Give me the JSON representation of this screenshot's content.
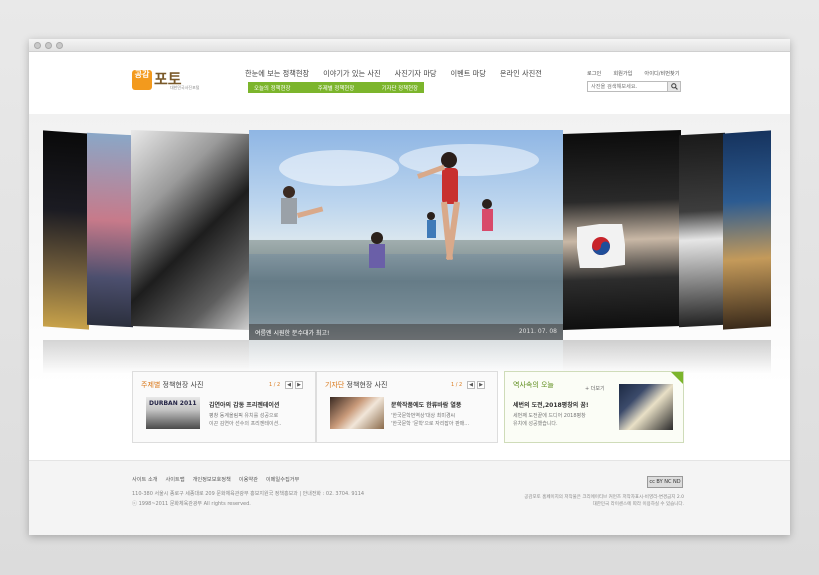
{
  "nav": {
    "items": [
      "한눈에 보는 정책현장",
      "이야기가 있는 사진",
      "사진기자 마당",
      "이벤트 마당",
      "온라인 사진전"
    ],
    "sub_items": [
      "오늘의 정책현장",
      "주제별 정책현장",
      "기자단 정책현장"
    ]
  },
  "brand": {
    "logo_box": "공감",
    "logo_text": "포토",
    "logo_sub": "대한민국사진포털",
    "accent_color": "#f39a1d",
    "green_color": "#7cb52c"
  },
  "util": {
    "links": [
      "로그인",
      "회원가입",
      "아이디/비번찾기"
    ],
    "search_placeholder": "사진을 검색해보세요."
  },
  "main_photo": {
    "caption": "여름엔 시원한 분수대가 최고!",
    "date": "2011. 07. 08"
  },
  "boxes": {
    "theme": {
      "title_accent": "주제별",
      "title_rest": " 정책현장 사진",
      "pager": "1 / 2",
      "item_title": "김연아의 감동 프리젠테이션",
      "desc_line1": "평창 동계올림픽 유치를 성공으로",
      "desc_line2": "이끈 김연아 선수의 프리젠테이션..",
      "thumb_text": "DURBAN 2011"
    },
    "reporter": {
      "title_accent": "기자단",
      "title_rest": " 정책현장 사진",
      "pager": "1 / 2",
      "item_title": "문학작품에도 한류바람 열풍",
      "desc_line1": "'한국문학번역상'대상 최미경씨",
      "desc_line2": "'한국문학 '문학'으로 자리잡아 판매..."
    },
    "history": {
      "title": "역사속의 오늘",
      "more": "+ 더보기",
      "item_title": "세번의 도전,2018평창의 꿈!",
      "desc_line1": "세번째 도전끝에 드디어 2018평창",
      "desc_line2": "유치에 성공했습니다."
    }
  },
  "footer": {
    "links": [
      "사이트 소개",
      "사이트맵",
      "개인정보보호정책",
      "이용약관",
      "이메일수집거부"
    ],
    "address": "110-380 서울시 종로구 세종대로 209 문화체육관광부 홍보지원국 정책홍보과  |  안내전화 : 02. 3704. 9114",
    "copyright": "ⓒ 1998~2011 문화체육관광부 All rights reserved.",
    "license_line1": "공감포토 홈페이지의 저작물은 크리에이티브 커먼즈 저작자표시-비영리-변경금지 2.0",
    "license_line2": "대한민국 라이센스에 따라 이용하실 수 있습니다.",
    "cc_badge": "cc BY NC ND"
  }
}
